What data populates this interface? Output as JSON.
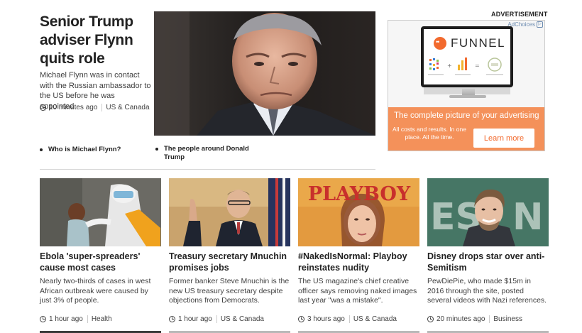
{
  "lead": {
    "title": "Senior Trump adviser Flynn quits role",
    "summary": "Michael Flynn was in contact with the Russian ambassador to the US before he was appointed.",
    "time": "10 minutes ago",
    "section": "US & Canada",
    "related": [
      "Who is Michael Flynn?",
      "The people around Donald Trump"
    ]
  },
  "advert": {
    "label": "ADVERTISEMENT",
    "adchoices": "AdChoices",
    "brand": "FUNNEL",
    "headline": "The complete picture of your advertising",
    "subline": "All costs and results. In one place. All the time.",
    "cta": "Learn more",
    "accent_color": "#f26a2e"
  },
  "cards": [
    {
      "title": "Ebola 'super-spreaders' cause most cases",
      "summary": "Nearly two-thirds of cases in west African outbreak were caused by just 3% of people.",
      "time": "1 hour ago",
      "section": "Health"
    },
    {
      "title": "Treasury secretary Mnuchin promises jobs",
      "summary": "Former banker Steve Mnuchin is the new US treasury secretary despite objections from Democrats.",
      "time": "1 hour ago",
      "section": "US & Canada"
    },
    {
      "title": "#NakedIsNormal: Playboy reinstates nudity",
      "summary": "The US magazine's chief creative officer says removing naked images last year \"was a mistake\".",
      "time": "3 hours ago",
      "section": "US & Canada",
      "image_text": "PLAYBOY"
    },
    {
      "title": "Disney drops star over anti-Semitism",
      "summary": "PewDiePie, who made $15m in 2016 through the site, posted several videos with Nazi references.",
      "time": "20 minutes ago",
      "section": "Business"
    }
  ]
}
